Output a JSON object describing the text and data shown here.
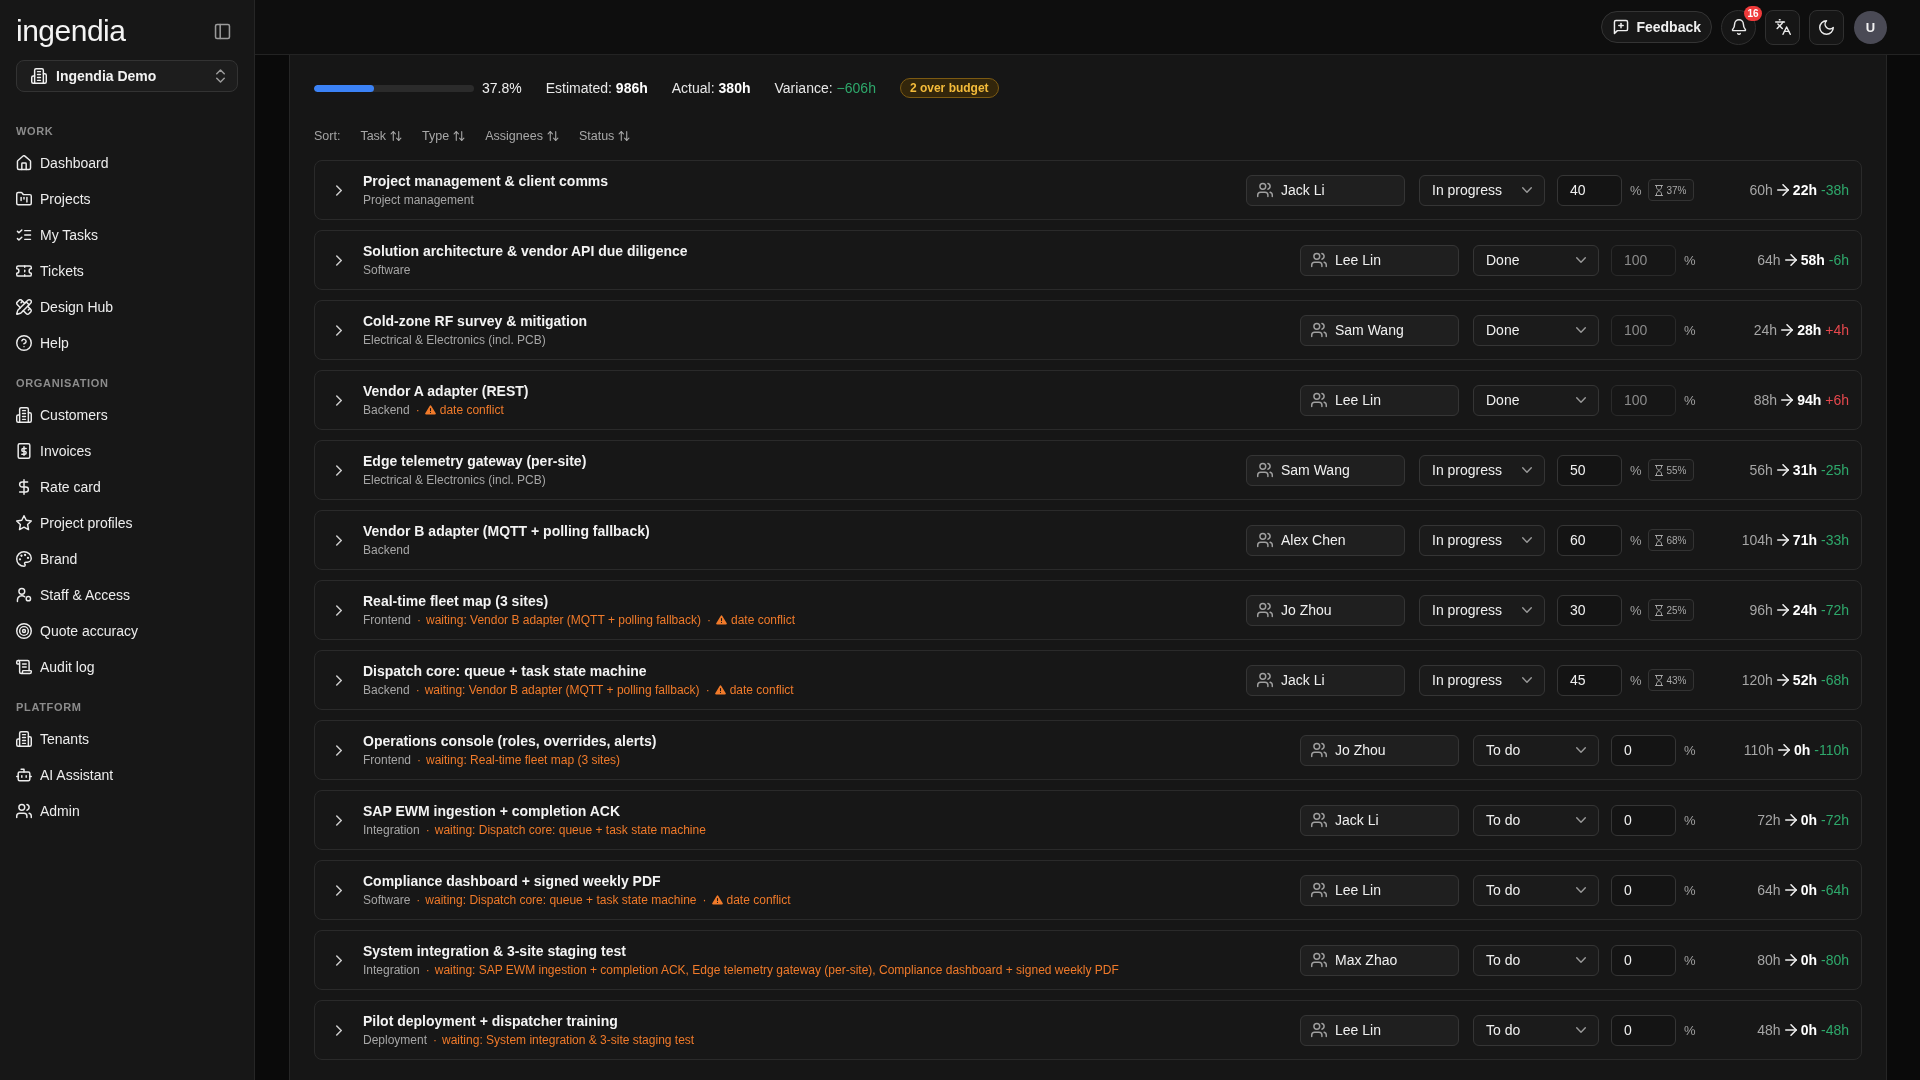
{
  "sidebar": {
    "logo": "ingendia",
    "workspace": "Ingendia Demo",
    "sections": [
      {
        "label": "WORK",
        "items": [
          {
            "label": "Dashboard",
            "selected": false
          },
          {
            "label": "Projects",
            "selected": false
          },
          {
            "label": "My Tasks",
            "selected": false
          },
          {
            "label": "Tickets",
            "selected": false
          },
          {
            "label": "Design Hub",
            "selected": false
          },
          {
            "label": "Help",
            "selected": false
          }
        ]
      },
      {
        "label": "ORGANISATION",
        "items": [
          {
            "label": "Customers",
            "selected": false
          },
          {
            "label": "Invoices",
            "selected": false
          },
          {
            "label": "Rate card",
            "selected": false
          },
          {
            "label": "Project profiles",
            "selected": false
          },
          {
            "label": "Brand",
            "selected": false
          },
          {
            "label": "Staff & Access",
            "selected": false
          },
          {
            "label": "Quote accuracy",
            "selected": false
          },
          {
            "label": "Audit log",
            "selected": false
          }
        ]
      },
      {
        "label": "PLATFORM",
        "items": [
          {
            "label": "Tenants",
            "selected": false
          },
          {
            "label": "AI Assistant",
            "selected": false
          },
          {
            "label": "Admin",
            "selected": false
          }
        ]
      }
    ]
  },
  "header": {
    "feedback": "Feedback",
    "notification_count": "16",
    "avatar": "U"
  },
  "summary": {
    "progress": {
      "level": 0.378,
      "label": "37.8%"
    },
    "estimated": {
      "label": "Estimated:",
      "value": "986h"
    },
    "actual": {
      "label": "Actual:",
      "value": "380h"
    },
    "variance": {
      "label": "Variance:",
      "value": "−606h",
      "over_budget": false
    },
    "badge": "2 over budget"
  },
  "sort": {
    "label": "Sort:",
    "fields": [
      "Task",
      "Type",
      "Assignees",
      "Status"
    ]
  },
  "tasks": [
    {
      "title": "Project management & client comms",
      "type": "Project management",
      "assignee": "Jack Li",
      "status": "In progress",
      "percent": {
        "value": "40",
        "unit": "%",
        "locked": false
      },
      "time_used": "37%",
      "hours": {
        "estimated": "60h",
        "actual": "22h",
        "variance": "-38h",
        "over_budget": false
      }
    },
    {
      "title": "Solution architecture & vendor API due diligence",
      "type": "Software",
      "assignee": "Lee Lin",
      "status": "Done",
      "percent": {
        "value": "100",
        "unit": "%",
        "locked": true
      },
      "hours": {
        "estimated": "64h",
        "actual": "58h",
        "variance": "-6h",
        "over_budget": false
      }
    },
    {
      "title": "Cold-zone RF survey & mitigation",
      "type": "Electrical & Electronics (incl. PCB)",
      "assignee": "Sam Wang",
      "status": "Done",
      "percent": {
        "value": "100",
        "unit": "%",
        "locked": true
      },
      "hours": {
        "estimated": "24h",
        "actual": "28h",
        "variance": "+4h",
        "over_budget": true
      }
    },
    {
      "title": "Vendor A adapter (REST)",
      "type": "Backend",
      "notes": [
        {
          "kind": "conflict",
          "separator": "·",
          "text": "date conflict"
        }
      ],
      "assignee": "Lee Lin",
      "status": "Done",
      "percent": {
        "value": "100",
        "unit": "%",
        "locked": true
      },
      "hours": {
        "estimated": "88h",
        "actual": "94h",
        "variance": "+6h",
        "over_budget": true
      }
    },
    {
      "title": "Edge telemetry gateway (per-site)",
      "type": "Electrical & Electronics (incl. PCB)",
      "assignee": "Sam Wang",
      "status": "In progress",
      "percent": {
        "value": "50",
        "unit": "%",
        "locked": false
      },
      "time_used": "55%",
      "hours": {
        "estimated": "56h",
        "actual": "31h",
        "variance": "-25h",
        "over_budget": false
      }
    },
    {
      "title": "Vendor B adapter (MQTT + polling fallback)",
      "type": "Backend",
      "assignee": "Alex Chen",
      "status": "In progress",
      "percent": {
        "value": "60",
        "unit": "%",
        "locked": false
      },
      "time_used": "68%",
      "hours": {
        "estimated": "104h",
        "actual": "71h",
        "variance": "-33h",
        "over_budget": false
      }
    },
    {
      "title": "Real-time fleet map (3 sites)",
      "type": "Frontend",
      "notes": [
        {
          "kind": "waiting",
          "separator": "·",
          "text": "waiting: Vendor B adapter (MQTT + polling fallback)"
        },
        {
          "kind": "conflict",
          "separator": "·",
          "text": "date conflict"
        }
      ],
      "assignee": "Jo Zhou",
      "status": "In progress",
      "percent": {
        "value": "30",
        "unit": "%",
        "locked": false
      },
      "time_used": "25%",
      "hours": {
        "estimated": "96h",
        "actual": "24h",
        "variance": "-72h",
        "over_budget": false
      }
    },
    {
      "title": "Dispatch core: queue + task state machine",
      "type": "Backend",
      "notes": [
        {
          "kind": "waiting",
          "separator": "·",
          "text": "waiting: Vendor B adapter (MQTT + polling fallback)"
        },
        {
          "kind": "conflict",
          "separator": "·",
          "text": "date conflict"
        }
      ],
      "assignee": "Jack Li",
      "status": "In progress",
      "percent": {
        "value": "45",
        "unit": "%",
        "locked": false
      },
      "time_used": "43%",
      "hours": {
        "estimated": "120h",
        "actual": "52h",
        "variance": "-68h",
        "over_budget": false
      }
    },
    {
      "title": "Operations console (roles, overrides, alerts)",
      "type": "Frontend",
      "notes": [
        {
          "kind": "waiting",
          "separator": "·",
          "text": "waiting: Real-time fleet map (3 sites)"
        }
      ],
      "assignee": "Jo Zhou",
      "status": "To do",
      "percent": {
        "value": "0",
        "unit": "%",
        "locked": false
      },
      "hours": {
        "estimated": "110h",
        "actual": "0h",
        "variance": "-110h",
        "over_budget": false
      }
    },
    {
      "title": "SAP EWM ingestion + completion ACK",
      "type": "Integration",
      "notes": [
        {
          "kind": "waiting",
          "separator": "·",
          "text": "waiting: Dispatch core: queue + task state machine"
        }
      ],
      "assignee": "Jack Li",
      "status": "To do",
      "percent": {
        "value": "0",
        "unit": "%",
        "locked": false
      },
      "hours": {
        "estimated": "72h",
        "actual": "0h",
        "variance": "-72h",
        "over_budget": false
      }
    },
    {
      "title": "Compliance dashboard + signed weekly PDF",
      "type": "Software",
      "notes": [
        {
          "kind": "waiting",
          "separator": "·",
          "text": "waiting: Dispatch core: queue + task state machine"
        },
        {
          "kind": "conflict",
          "separator": "·",
          "text": "date conflict"
        }
      ],
      "assignee": "Lee Lin",
      "status": "To do",
      "percent": {
        "value": "0",
        "unit": "%",
        "locked": false
      },
      "hours": {
        "estimated": "64h",
        "actual": "0h",
        "variance": "-64h",
        "over_budget": false
      }
    },
    {
      "title": "System integration & 3-site staging test",
      "type": "Integration",
      "notes": [
        {
          "kind": "waiting",
          "separator": "·",
          "text": "waiting: SAP EWM ingestion + completion ACK, Edge telemetry gateway (per-site), Compliance dashboard + signed weekly PDF"
        }
      ],
      "assignee": "Max Zhao",
      "status": "To do",
      "percent": {
        "value": "0",
        "unit": "%",
        "locked": false
      },
      "hours": {
        "estimated": "80h",
        "actual": "0h",
        "variance": "-80h",
        "over_budget": false
      }
    },
    {
      "title": "Pilot deployment + dispatcher training",
      "type": "Deployment",
      "notes": [
        {
          "kind": "waiting",
          "separator": "·",
          "text": "waiting: System integration & 3-site staging test"
        }
      ],
      "assignee": "Lee Lin",
      "status": "To do",
      "percent": {
        "value": "0",
        "unit": "%",
        "locked": false
      },
      "hours": {
        "estimated": "48h",
        "actual": "0h",
        "variance": "-48h",
        "over_budget": false
      }
    }
  ]
}
